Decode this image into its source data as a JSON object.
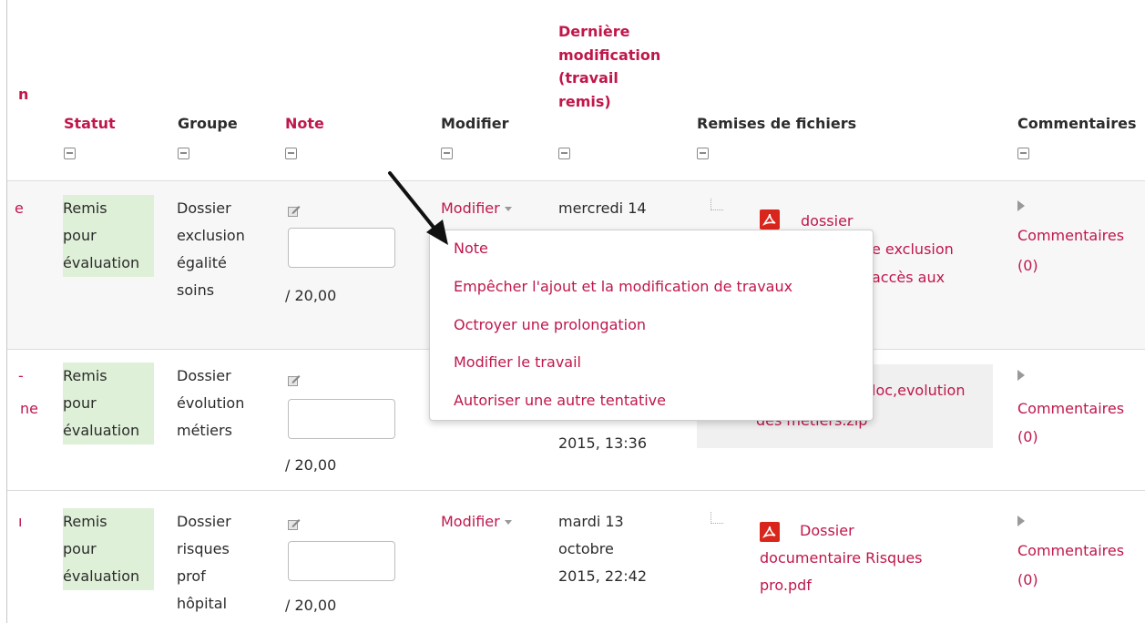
{
  "header": {
    "cut_label": "n",
    "statut": "Statut",
    "groupe": "Groupe",
    "note": "Note",
    "modifier": "Modifier",
    "derniere": [
      "Dernière",
      "modification",
      "(travail",
      "remis)"
    ],
    "remises": "Remises de fichiers",
    "commentaires": "Commentaires"
  },
  "rows": [
    {
      "cut_fragments": [
        "e"
      ],
      "status": [
        "Remis",
        "pour",
        "évaluation"
      ],
      "group": [
        "Dossier",
        "exclusion",
        "égalité",
        "soins"
      ],
      "grade_suffix": "/ 20,00",
      "modifier_label": "Modifier",
      "date": [
        "mercredi 14"
      ],
      "file_lines": [
        "dossier",
        "e exclusion",
        "accès aux"
      ],
      "comments_label": "Commentaires",
      "comments_count": "(0)"
    },
    {
      "cut_fragments": [
        "-",
        "ne"
      ],
      "status": [
        "Remis",
        "pour",
        "évaluation"
      ],
      "group": [
        "Dossier",
        "évolution",
        "métiers"
      ],
      "grade_suffix": "/ 20,00",
      "date": [
        "2015, 13:36"
      ],
      "file_lines": [
        "loc,evolution",
        "des métiers.zip"
      ],
      "comments_label": "Commentaires",
      "comments_count": "(0)"
    },
    {
      "cut_fragments": [
        "ı"
      ],
      "status": [
        "Remis",
        "pour",
        "évaluation"
      ],
      "group": [
        "Dossier",
        "risques",
        "prof",
        "hôpital"
      ],
      "grade_suffix": "/ 20,00",
      "modifier_label": "Modifier",
      "date": [
        "mardi 13",
        "octobre",
        "2015, 22:42"
      ],
      "file_lines": [
        "Dossier",
        "documentaire Risques",
        "pro.pdf"
      ],
      "comments_label": "Commentaires",
      "comments_count": "(0)"
    }
  ],
  "menu": {
    "items": [
      "Note",
      "Empêcher l'ajout et la modification de travaux",
      "Octroyer une prolongation",
      "Modifier le travail",
      "Autoriser une autre tentative"
    ]
  },
  "colors": {
    "link": "#c0174b",
    "status_bg": "#dff0d8",
    "row_alt_bg": "#f7f7f7",
    "pdf_red": "#d9261c"
  },
  "icons": {
    "column_toggle": "minus-square-icon",
    "grade_edit": "edit-pencil-icon",
    "file": "pdf-icon",
    "comments": "triangle-right-icon",
    "tree": "tree-branch-icon",
    "annotation": "arrow-pointer"
  }
}
